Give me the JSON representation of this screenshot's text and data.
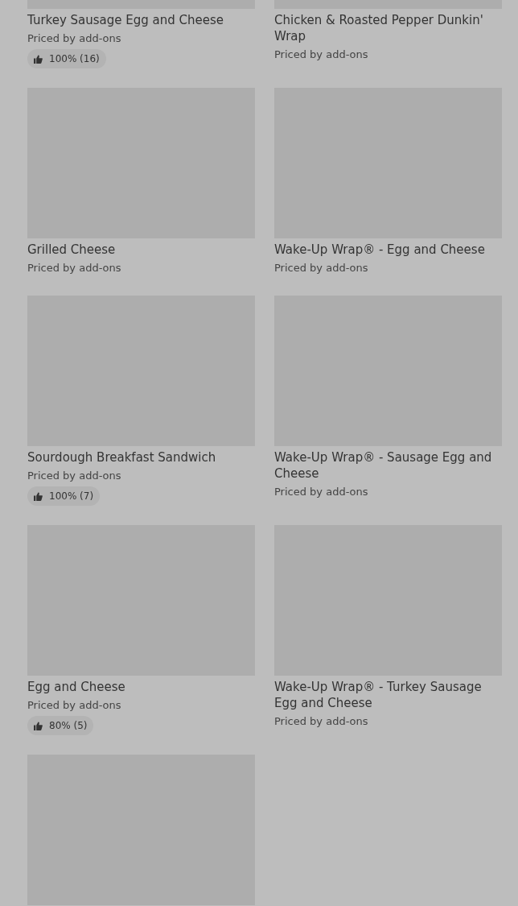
{
  "items": [
    {
      "kind": "product",
      "title": "Turkey Sausage Egg and Cheese",
      "price": "Priced by add-ons",
      "rating": "100% (16)"
    },
    {
      "kind": "product",
      "title": "Chicken & Roasted Pepper Dunkin' Wrap",
      "price": "Priced by add-ons"
    },
    {
      "kind": "product",
      "title": "Grilled Cheese",
      "price": "Priced by add-ons"
    },
    {
      "kind": "product",
      "title": "Wake-Up Wrap® - Egg and Cheese",
      "price": "Priced by add-ons"
    },
    {
      "kind": "product",
      "title": "Sourdough Breakfast Sandwich",
      "price": "Priced by add-ons",
      "rating": "100% (7)"
    },
    {
      "kind": "product",
      "title": "Wake-Up Wrap® - Sausage Egg and Cheese",
      "price": "Priced by add-ons"
    },
    {
      "kind": "product",
      "title": "Egg and Cheese",
      "price": "Priced by add-ons",
      "rating": "80% (5)"
    },
    {
      "kind": "product",
      "title": "Wake-Up Wrap® - Turkey Sausage Egg and Cheese",
      "price": "Priced by add-ons"
    },
    {
      "kind": "picture"
    }
  ]
}
